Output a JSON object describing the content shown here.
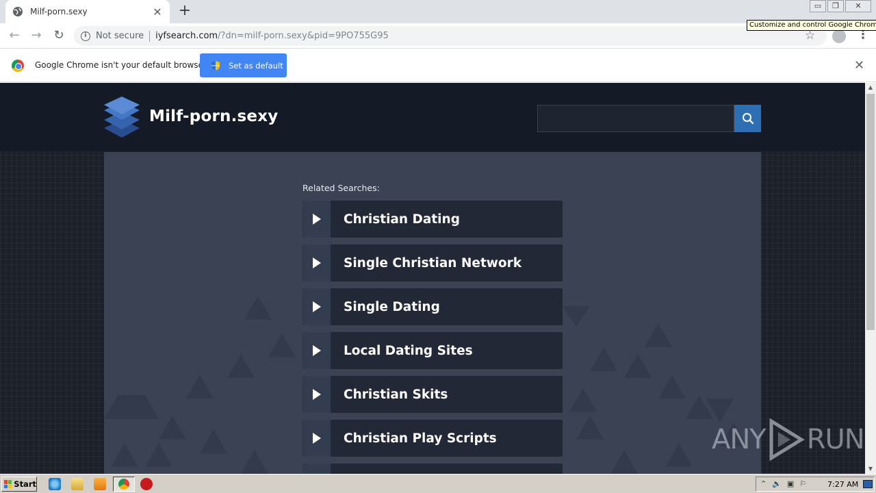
{
  "browser": {
    "tab_title": "Milf-porn.sexy",
    "tab_close": "✕",
    "new_tab": "+",
    "security_label": "Not secure",
    "url_host": "iyfsearch.com",
    "url_rest": "/?dn=milf-porn.sexy&pid=9PO755G95",
    "tooltip": "Customize and control Google Chrome",
    "window_minimize": "▭",
    "window_restore": "❐",
    "window_close": "✕"
  },
  "infobar": {
    "message": "Google Chrome isn't your default browser",
    "button_label": "Set as default",
    "close": "✕"
  },
  "site": {
    "title": "Milf-porn.sexy",
    "search_placeholder": "",
    "related_label": "Related Searches:",
    "results": [
      "Christian Dating",
      "Single Christian Network",
      "Single Dating",
      "Local Dating Sites",
      "Christian Skits",
      "Christian Play Scripts",
      ""
    ]
  },
  "watermark": {
    "left": "ANY",
    "right": "RUN"
  },
  "taskbar": {
    "start_label": "Start",
    "clock": "7:27 AM"
  },
  "colors": {
    "header_bg": "#151b26",
    "panel_bg": "#3a4254",
    "result_bg": "#222836",
    "search_button": "#2e6fb4",
    "set_default_button": "#4285f4"
  }
}
